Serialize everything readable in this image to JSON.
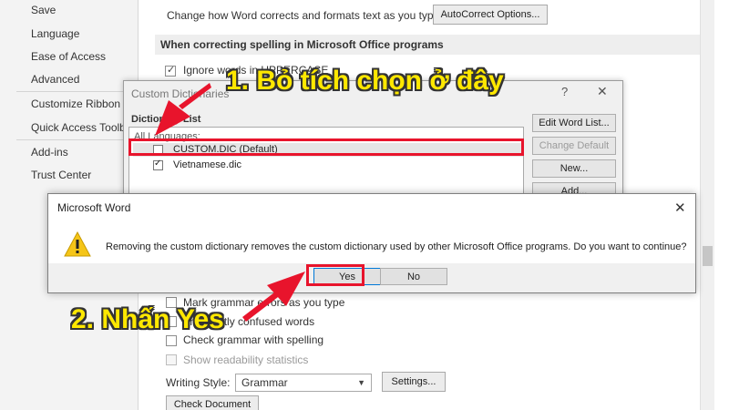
{
  "options_nav": {
    "items": [
      "Save",
      "Language",
      "Ease of Access",
      "Advanced",
      "Customize Ribbon",
      "Quick Access Toolba",
      "Add-ins",
      "Trust Center"
    ]
  },
  "proofing": {
    "autocorrect_text": "Change how Word corrects and formats text as you type:",
    "autocorrect_button": "AutoCorrect Options...",
    "spelling_header": "When correcting spelling in Microsoft Office programs",
    "ignore_uppercase": "Ignore words in UPPERCASE",
    "mark_grammar": "Mark grammar errors as you type",
    "frequently_confused": "Frequently confused words",
    "check_grammar": "Check grammar with spelling",
    "readability": "Show readability statistics",
    "writing_style_label": "Writing Style:",
    "writing_style_value": "Grammar",
    "settings_button": "Settings...",
    "check_document_button": "Check Document"
  },
  "custom_dictionaries": {
    "title": "Custom Dictionaries",
    "help": "?",
    "close": "✕",
    "list_label": "Dictionary List",
    "all_languages": "All Languages:",
    "entries": [
      {
        "label": "CUSTOM.DIC (Default)",
        "checked": false
      },
      {
        "label": "Vietnamese.dic",
        "checked": true
      }
    ],
    "buttons": {
      "edit": "Edit Word List...",
      "change_default": "Change Default",
      "new": "New...",
      "add": "Add..."
    }
  },
  "message_box": {
    "title": "Microsoft Word",
    "close": "✕",
    "message": "Removing the custom dictionary removes the custom dictionary used by other Microsoft Office programs. Do you want to continue?",
    "yes": "Yes",
    "no": "No"
  },
  "annotations": {
    "step1": "1. Bỏ tích chọn ở đây",
    "step2": "2. Nhấn Yes",
    "highlight_color": "#e8142c",
    "text_color": "#ffe800"
  }
}
